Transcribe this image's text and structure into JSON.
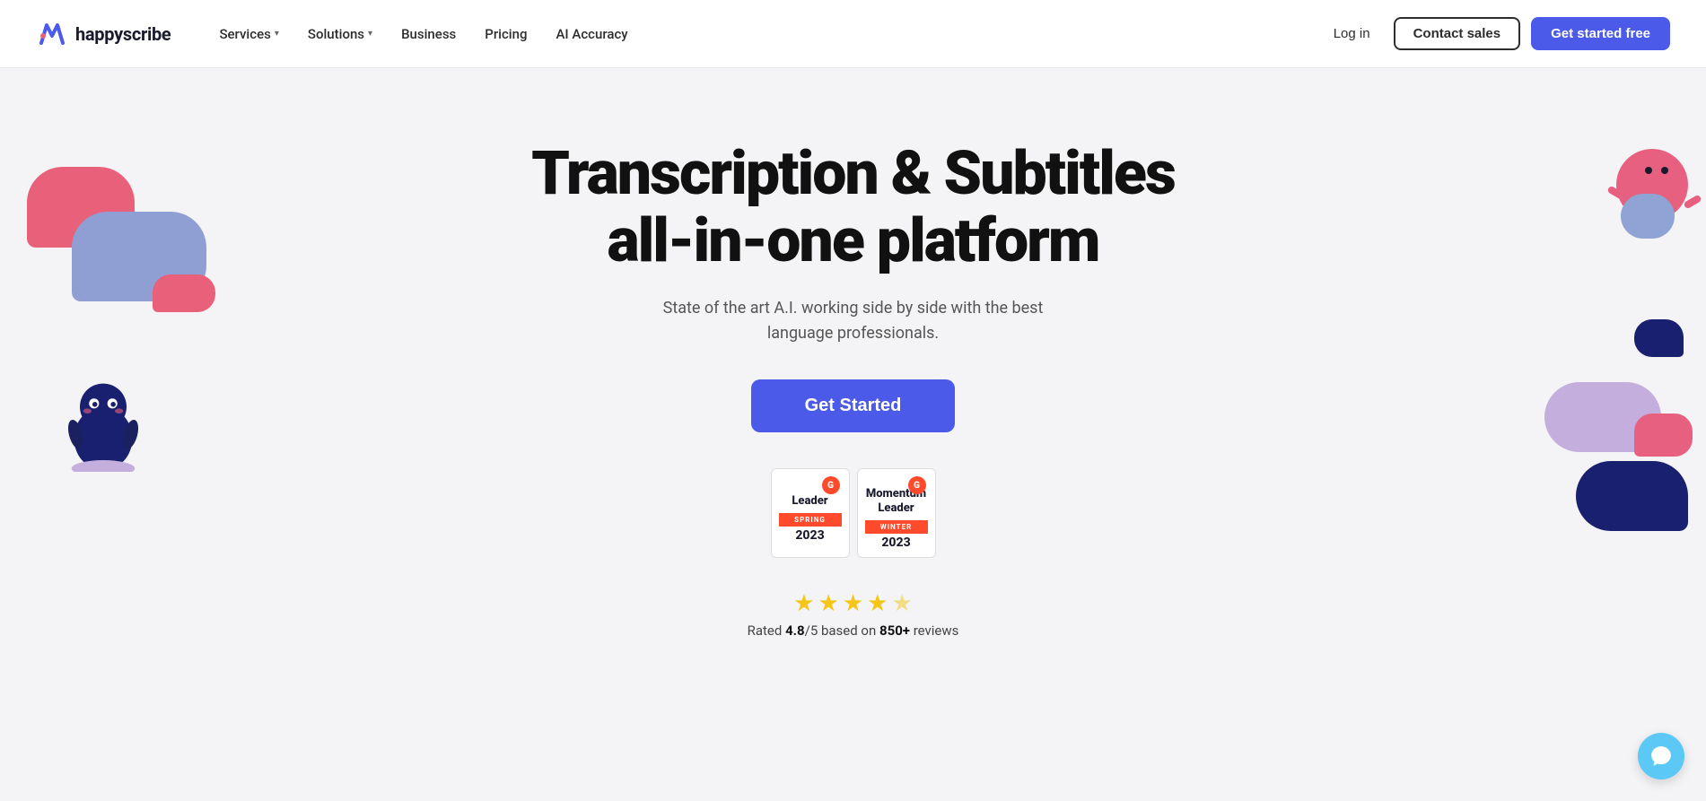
{
  "brand": {
    "name": "happyscribe",
    "logo_alt": "HappyScribe Logo"
  },
  "nav": {
    "links": [
      {
        "label": "Services",
        "has_dropdown": true
      },
      {
        "label": "Solutions",
        "has_dropdown": true
      },
      {
        "label": "Business",
        "has_dropdown": false
      },
      {
        "label": "Pricing",
        "has_dropdown": false
      },
      {
        "label": "AI Accuracy",
        "has_dropdown": false
      }
    ],
    "login_label": "Log in",
    "contact_label": "Contact sales",
    "cta_label": "Get started free"
  },
  "hero": {
    "title": "Transcription & Subtitles all-in-one platform",
    "subtitle": "State of the art A.I. working side by side with the best language professionals.",
    "cta_label": "Get Started",
    "badges": [
      {
        "g2_letter": "G",
        "title": "Leader",
        "season": "SPRING",
        "year": "2023"
      },
      {
        "g2_letter": "G",
        "title": "Momentum Leader",
        "season": "WINTER",
        "year": "2023"
      }
    ],
    "stars_count": 4.5,
    "stars_display": "★★★★☆",
    "rating": "4.8",
    "rating_scale": "5",
    "reviews_count": "850+",
    "rating_text_prefix": "Rated ",
    "rating_text_middle": "/5 based on ",
    "rating_text_suffix": " reviews"
  },
  "chat_button": {
    "aria_label": "Open chat"
  }
}
